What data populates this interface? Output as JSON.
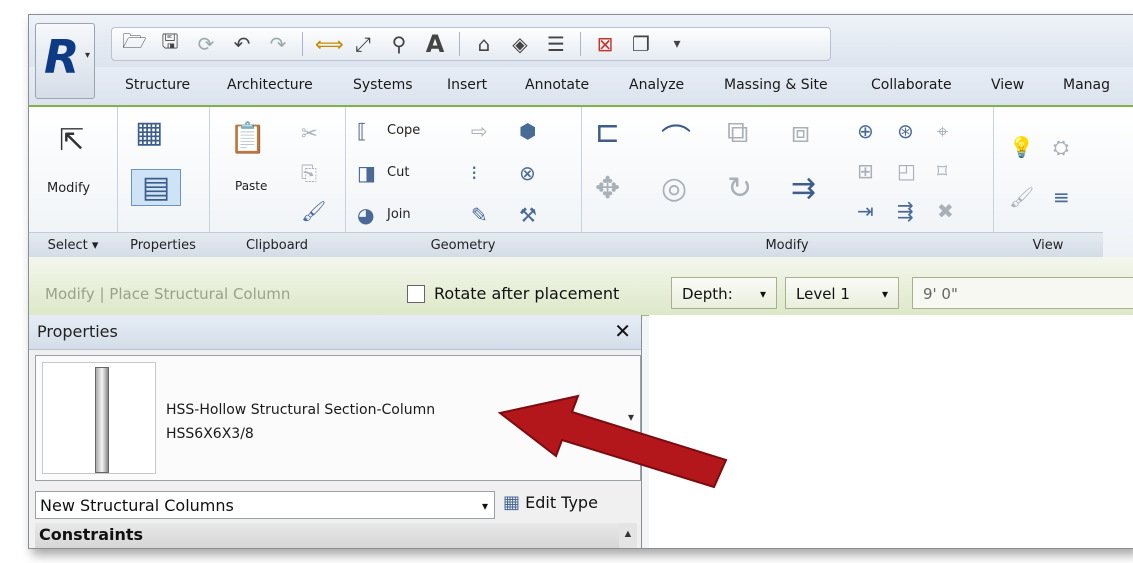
{
  "app": {
    "logo_letter": "R"
  },
  "quick_access": {
    "icons": [
      "open-icon",
      "save-icon",
      "sync-icon",
      "undo-icon",
      "redo-icon",
      "measure-icon",
      "dimension-icon",
      "tag-icon",
      "text-icon",
      "3d-view-icon",
      "section-icon",
      "thin-lines-icon",
      "close-hidden-icon",
      "switch-windows-icon",
      "customize-icon"
    ],
    "text_glyph": "A"
  },
  "tabs": [
    "Structure",
    "Architecture",
    "Systems",
    "Insert",
    "Annotate",
    "Analyze",
    "Massing & Site",
    "Collaborate",
    "View",
    "Manag"
  ],
  "ribbon": {
    "select": {
      "modify_label": "Modify",
      "panel_label": "Select ▾"
    },
    "properties": {
      "panel_label": "Properties"
    },
    "clipboard": {
      "paste_label": "Paste",
      "panel_label": "Clipboard"
    },
    "geometry": {
      "cope_label": "Cope",
      "cut_label": "Cut",
      "join_label": "Join",
      "panel_label": "Geometry"
    },
    "modify": {
      "panel_label": "Modify"
    },
    "view": {
      "panel_label": "View"
    }
  },
  "options_bar": {
    "context_label": "Modify | Place Structural Column",
    "rotate_label": "Rotate after placement",
    "rotate_checked": false,
    "depth_label": "Depth:",
    "level_label": "Level 1",
    "height_value": "9'  0\""
  },
  "properties_palette": {
    "title": "Properties",
    "close_glyph": "✕",
    "family_name": "HSS-Hollow Structural Section-Column",
    "type_name": "HSS6X6X3/8",
    "instance_selector": "New Structural Columns",
    "edit_type_label": "Edit Type",
    "section_header": "Constraints"
  },
  "annotation": {
    "arrow_color": "#b3171b"
  }
}
